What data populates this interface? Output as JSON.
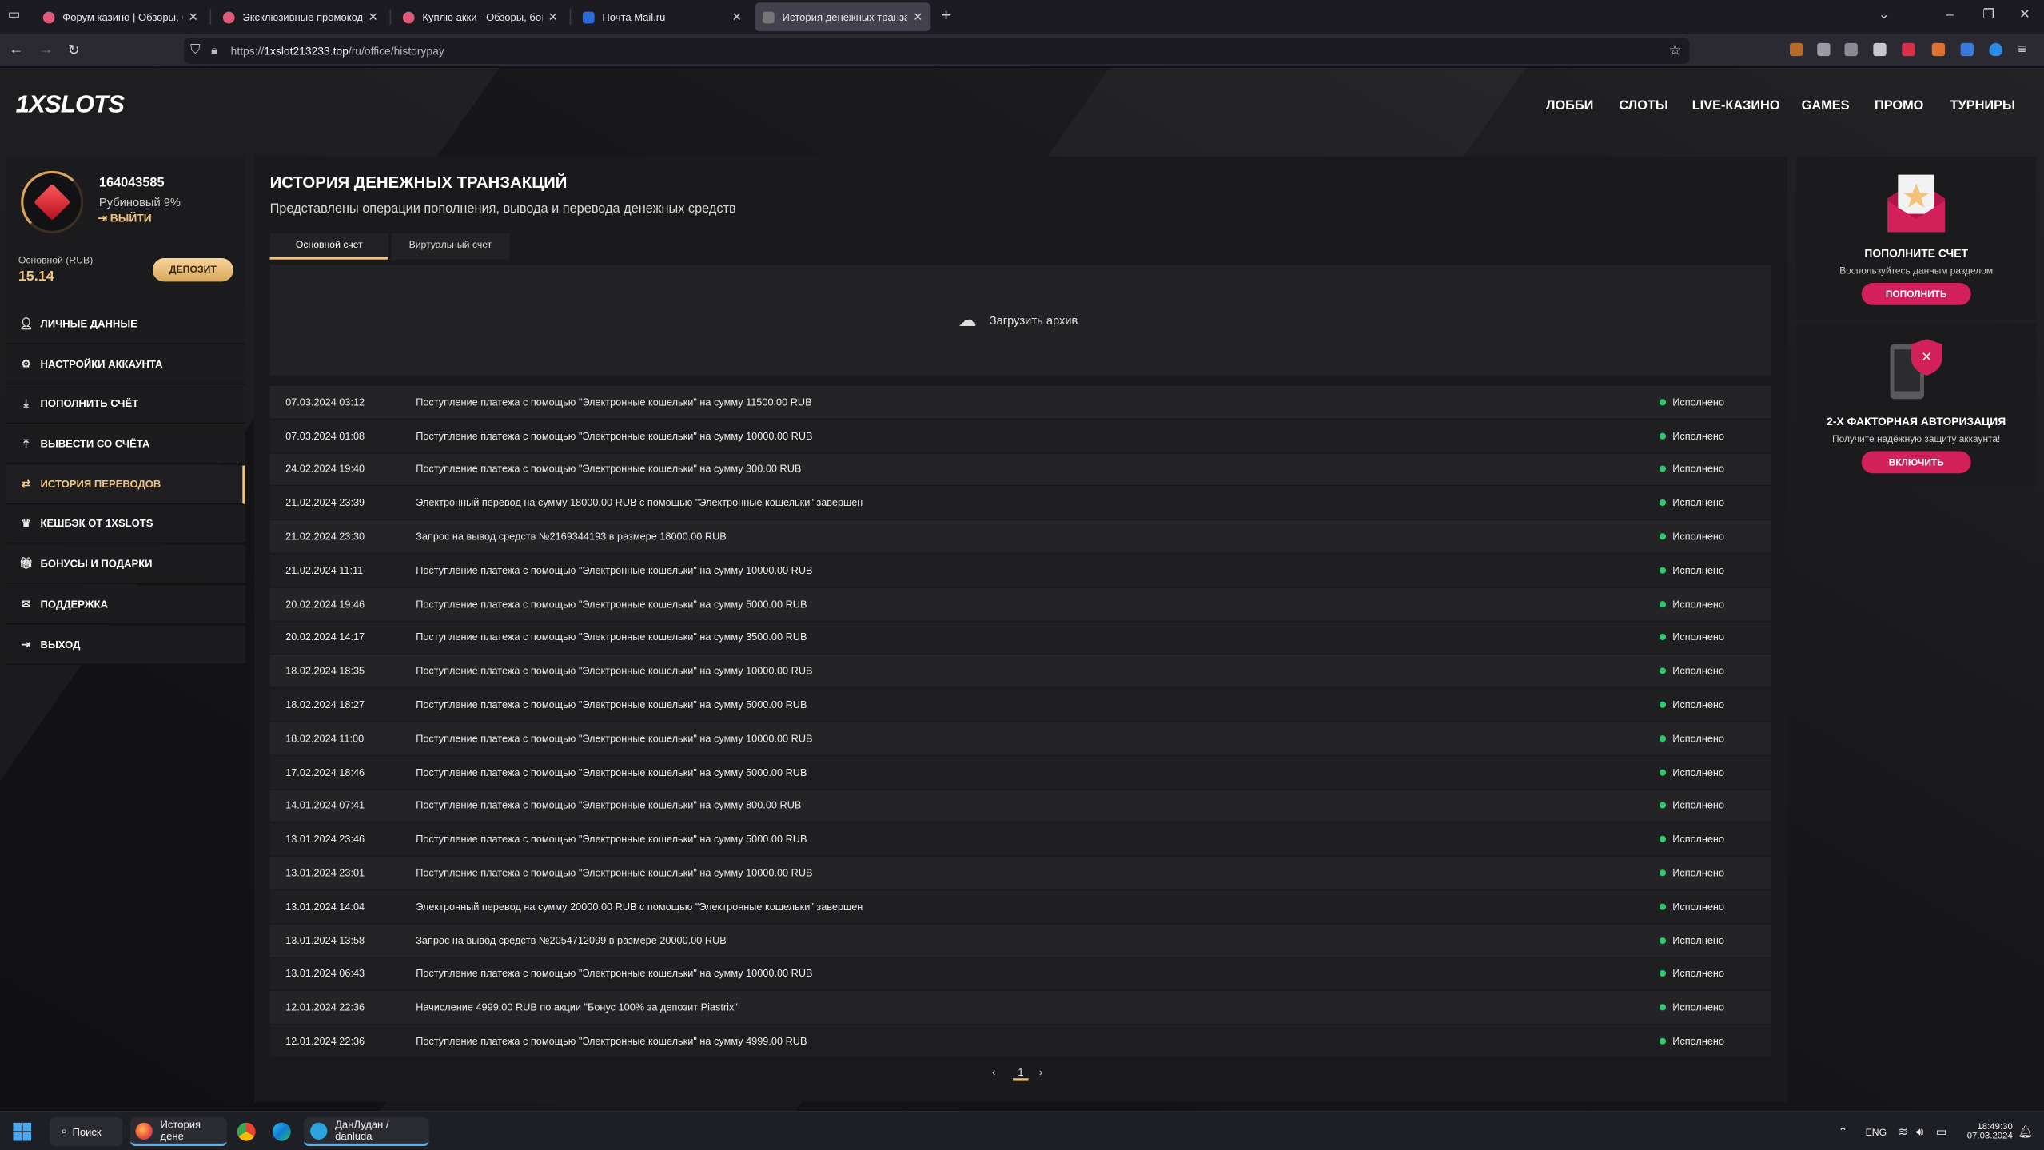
{
  "browser": {
    "tabs": [
      {
        "title": "Форум казино | Обзоры, бонус",
        "active": false
      },
      {
        "title": "Эксклюзивные промокоды на",
        "active": false
      },
      {
        "title": "Куплю акки - Обзоры, бонус",
        "active": false
      },
      {
        "title": "Почта Mail.ru",
        "active": false
      },
      {
        "title": "История денежных транзакций",
        "active": true
      }
    ],
    "url_prefix": "https://",
    "url_host": "1xslot213233.top",
    "url_path": "/ru/office/historypay"
  },
  "site": {
    "logo_a": "1X",
    "logo_b": "SLOTS",
    "nav": [
      "ЛОББИ",
      "СЛОТЫ",
      "LIVE-КАЗИНО",
      "GAMES",
      "ПРОМО",
      "ТУРНИРЫ"
    ]
  },
  "profile": {
    "id": "164043585",
    "level": "Рубиновый 9%",
    "logout": "ВЫЙТИ",
    "balance_label": "Основной (RUB)",
    "balance": "15.14",
    "deposit_button": "ДЕПОЗИТ"
  },
  "sidebar": [
    {
      "label": "ЛИЧНЫЕ ДАННЫЕ",
      "icon": "user-icon"
    },
    {
      "label": "НАСТРОЙКИ АККАУНТА",
      "icon": "gears-icon"
    },
    {
      "label": "ПОПОЛНИТЬ СЧЁТ",
      "icon": "download-icon"
    },
    {
      "label": "ВЫВЕСТИ СО СЧЁТА",
      "icon": "upload-icon"
    },
    {
      "label": "ИСТОРИЯ ПЕРЕВОДОВ",
      "icon": "transfer-icon",
      "active": true
    },
    {
      "label": "КЕШБЭК ОТ 1XSLOTS",
      "icon": "crown-icon"
    },
    {
      "label": "БОНУСЫ И ПОДАРКИ",
      "icon": "gift-icon"
    },
    {
      "label": "ПОДДЕРЖКА",
      "icon": "mail-icon"
    },
    {
      "label": "ВЫХОД",
      "icon": "exit-icon"
    }
  ],
  "main": {
    "title": "ИСТОРИЯ ДЕНЕЖНЫХ ТРАНЗАКЦИЙ",
    "subtitle": "Представлены операции пополнения, вывода и перевода денежных средств",
    "tabs": [
      "Основной счет",
      "Виртуальный счет"
    ],
    "upload_label": "Загрузить архив",
    "page": "1",
    "rows": [
      {
        "date": "07.03.2024 03:12",
        "text": "Поступление платежа с помощью \"Электронные кошельки\" на сумму 11500.00 RUB",
        "status": "Исполнено"
      },
      {
        "date": "07.03.2024 01:08",
        "text": "Поступление платежа с помощью \"Электронные кошельки\" на сумму 10000.00 RUB",
        "status": "Исполнено"
      },
      {
        "date": "24.02.2024 19:40",
        "text": "Поступление платежа с помощью \"Электронные кошельки\" на сумму 300.00 RUB",
        "status": "Исполнено"
      },
      {
        "date": "21.02.2024 23:39",
        "text": "Электронный перевод на сумму 18000.00 RUB с помощью \"Электронные кошельки\" завершен",
        "status": "Исполнено"
      },
      {
        "date": "21.02.2024 23:30",
        "text": "Запрос на вывод средств №2169344193 в размере 18000.00 RUB",
        "status": "Исполнено"
      },
      {
        "date": "21.02.2024 11:11",
        "text": "Поступление платежа с помощью \"Электронные кошельки\" на сумму 10000.00 RUB",
        "status": "Исполнено"
      },
      {
        "date": "20.02.2024 19:46",
        "text": "Поступление платежа с помощью \"Электронные кошельки\" на сумму 5000.00 RUB",
        "status": "Исполнено"
      },
      {
        "date": "20.02.2024 14:17",
        "text": "Поступление платежа с помощью \"Электронные кошельки\" на сумму 3500.00 RUB",
        "status": "Исполнено"
      },
      {
        "date": "18.02.2024 18:35",
        "text": "Поступление платежа с помощью \"Электронные кошельки\" на сумму 10000.00 RUB",
        "status": "Исполнено"
      },
      {
        "date": "18.02.2024 18:27",
        "text": "Поступление платежа с помощью \"Электронные кошельки\" на сумму 5000.00 RUB",
        "status": "Исполнено"
      },
      {
        "date": "18.02.2024 11:00",
        "text": "Поступление платежа с помощью \"Электронные кошельки\" на сумму 10000.00 RUB",
        "status": "Исполнено"
      },
      {
        "date": "17.02.2024 18:46",
        "text": "Поступление платежа с помощью \"Электронные кошельки\" на сумму 5000.00 RUB",
        "status": "Исполнено"
      },
      {
        "date": "14.01.2024 07:41",
        "text": "Поступление платежа с помощью \"Электронные кошельки\" на сумму 800.00 RUB",
        "status": "Исполнено"
      },
      {
        "date": "13.01.2024 23:46",
        "text": "Поступление платежа с помощью \"Электронные кошельки\" на сумму 5000.00 RUB",
        "status": "Исполнено"
      },
      {
        "date": "13.01.2024 23:01",
        "text": "Поступление платежа с помощью \"Электронные кошельки\" на сумму 10000.00 RUB",
        "status": "Исполнено"
      },
      {
        "date": "13.01.2024 14:04",
        "text": "Электронный перевод на сумму 20000.00 RUB с помощью \"Электронные кошельки\" завершен",
        "status": "Исполнено"
      },
      {
        "date": "13.01.2024 13:58",
        "text": "Запрос на вывод средств №2054712099 в размере 20000.00 RUB",
        "status": "Исполнено"
      },
      {
        "date": "13.01.2024 06:43",
        "text": "Поступление платежа с помощью \"Электронные кошельки\" на сумму 10000.00 RUB",
        "status": "Исполнено"
      },
      {
        "date": "12.01.2024 22:36",
        "text": "Начисление 4999.00 RUB по акции \"Бонус 100% за депозит Piastrix\"",
        "status": "Исполнено"
      },
      {
        "date": "12.01.2024 22:36",
        "text": "Поступление платежа с помощью \"Электронные кошельки\" на сумму 4999.00 RUB",
        "status": "Исполнено"
      }
    ]
  },
  "right": {
    "card1": {
      "title": "ПОПОЛНИТЕ СЧЕТ",
      "subtitle": "Воспользуйтесь данным разделом",
      "button": "ПОПОЛНИТЬ"
    },
    "card2": {
      "title": "2-Х ФАКТОРНАЯ АВТОРИЗАЦИЯ",
      "subtitle": "Получите надёжную защиту аккаунта!",
      "button": "ВКЛЮЧИТЬ"
    }
  },
  "taskbar": {
    "search": "Поиск",
    "firefox_item": "История дене",
    "telegram_item": "ДанЛудан / danluda",
    "lang": "ENG",
    "time": "18:49:30",
    "date": "07.03.2024"
  },
  "colors": {
    "accent": "#f0c27a",
    "promo": "#d1205a",
    "success": "#2ecc71"
  }
}
